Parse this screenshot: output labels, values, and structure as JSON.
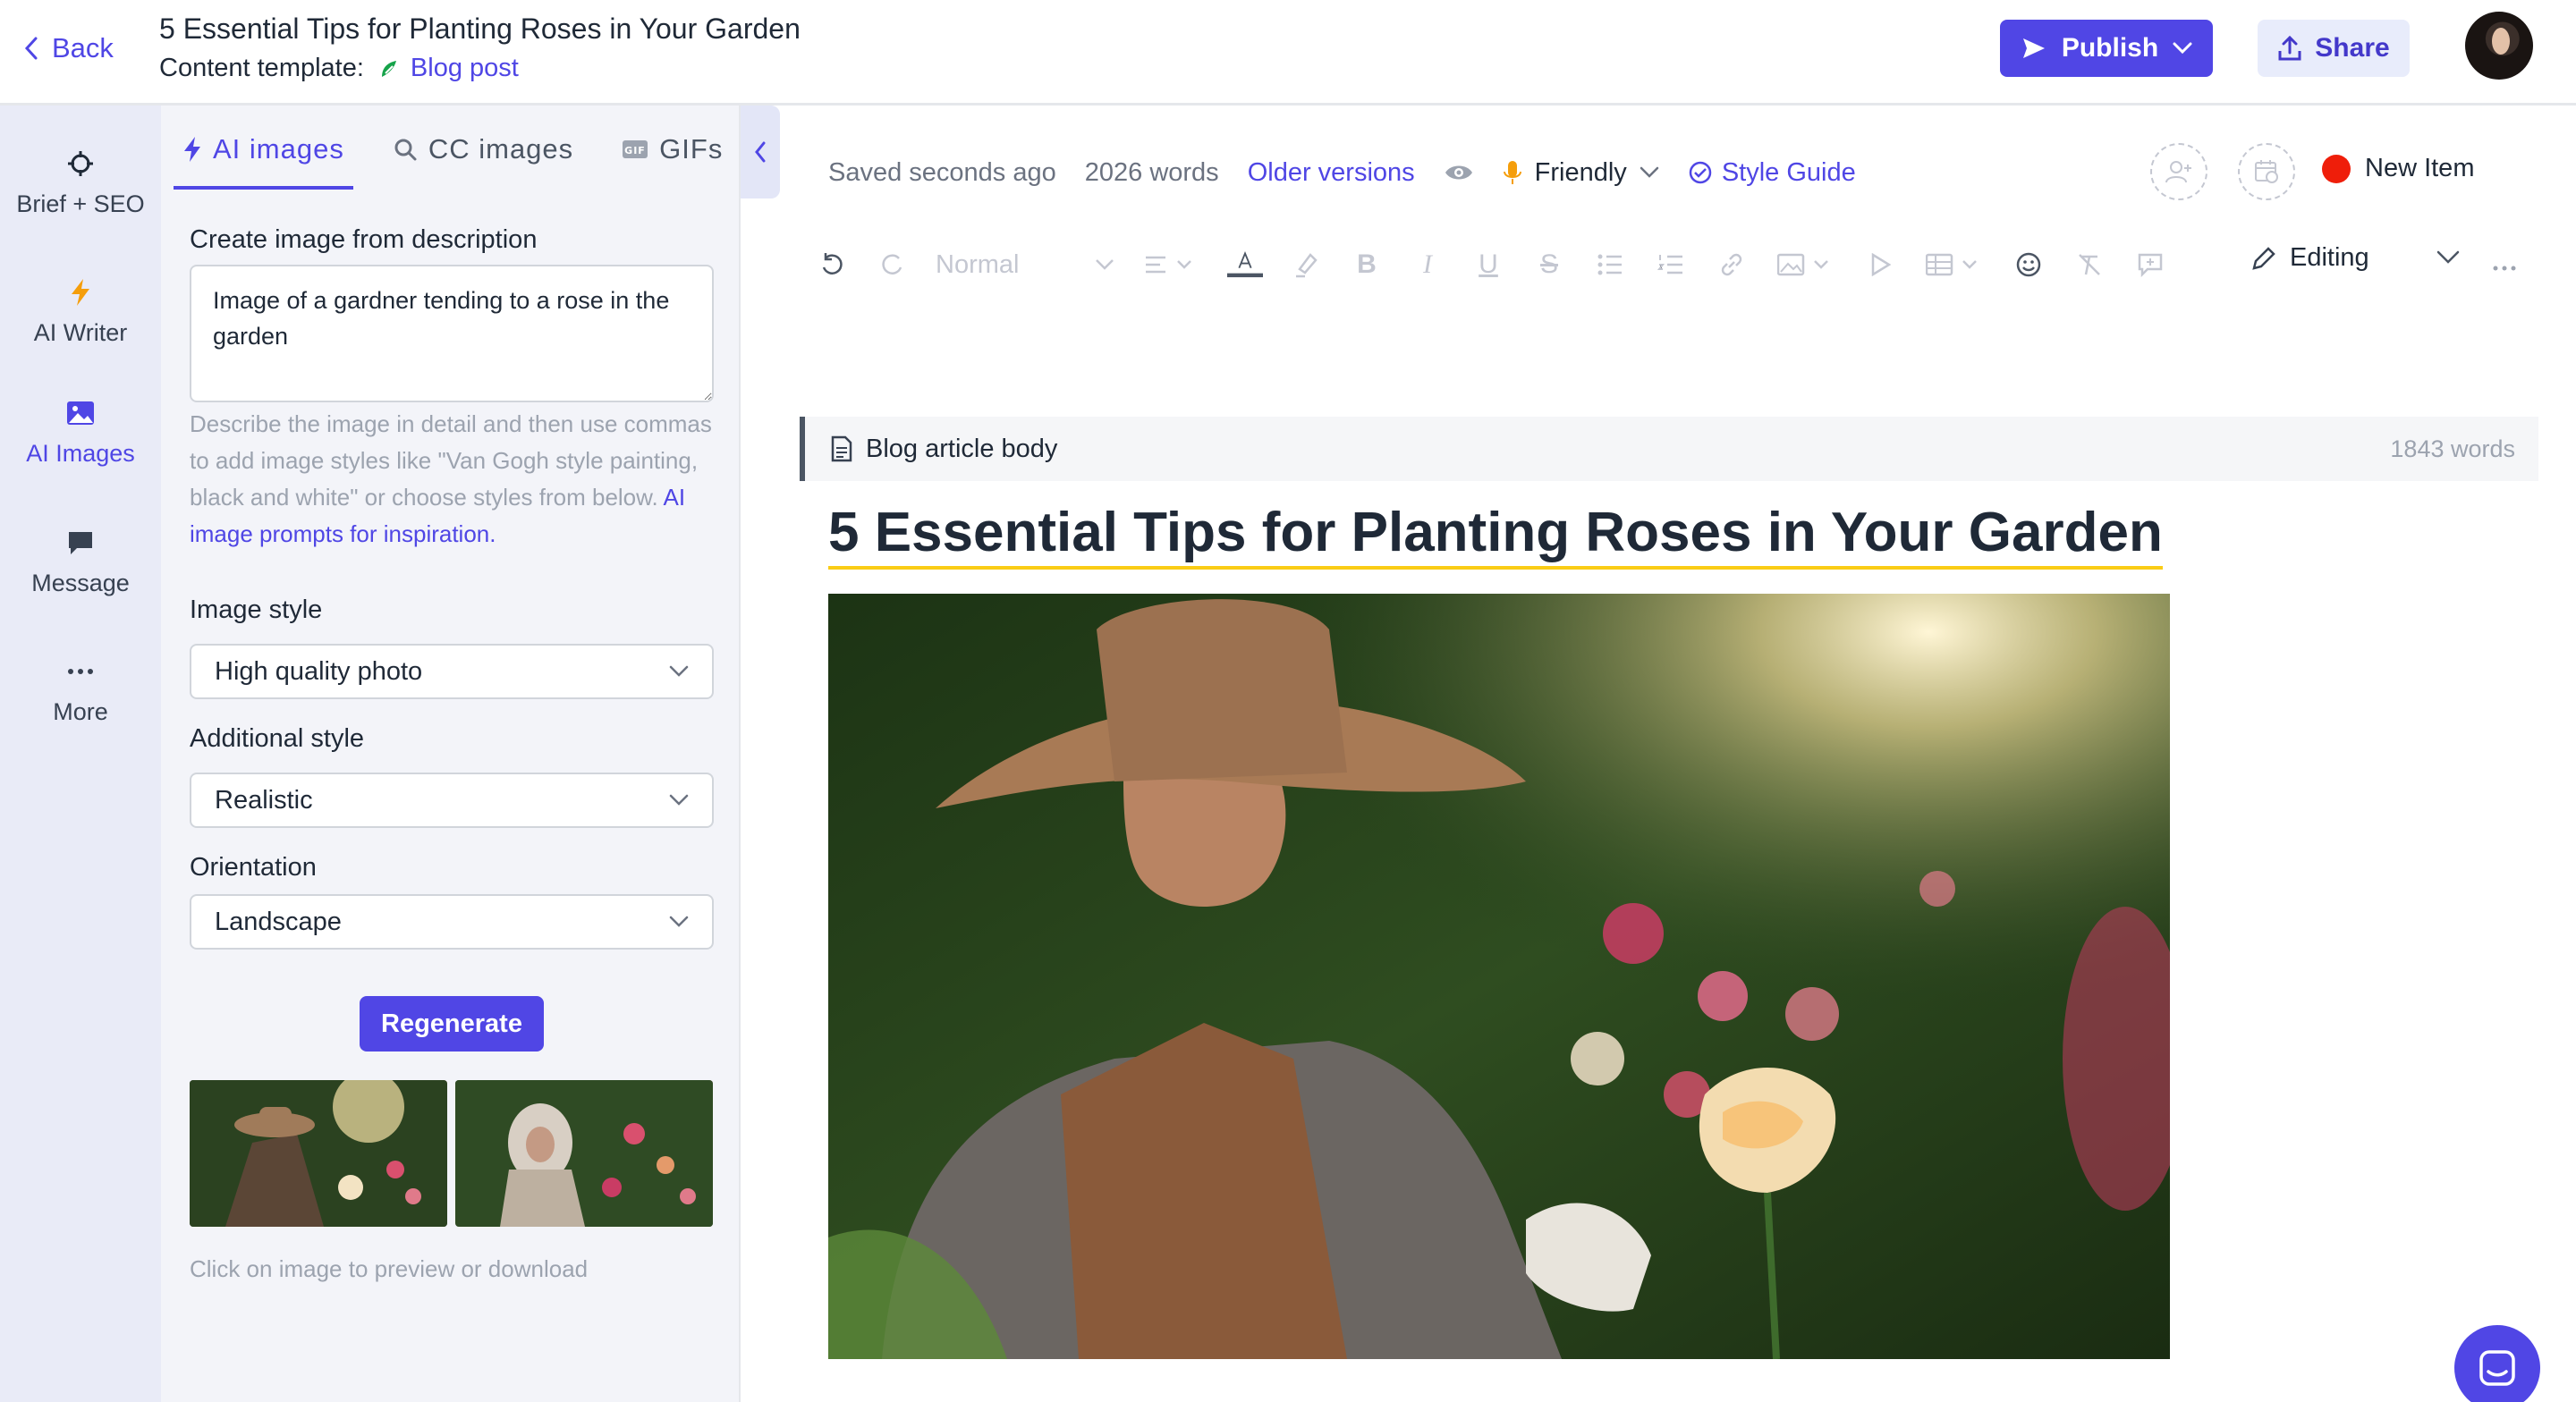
{
  "header": {
    "back_label": "Back",
    "title": "5 Essential Tips for Planting Roses in Your Garden",
    "template_label": "Content template:",
    "template_value": "Blog post",
    "publish_label": "Publish",
    "share_label": "Share"
  },
  "leftnav": {
    "items": [
      {
        "label": "Brief + SEO",
        "icon": "crosshair-icon"
      },
      {
        "label": "AI Writer",
        "icon": "bolt-icon"
      },
      {
        "label": "AI Images",
        "icon": "image-icon",
        "active": true
      },
      {
        "label": "Message",
        "icon": "message-icon"
      },
      {
        "label": "More",
        "icon": "ellipsis-icon"
      }
    ]
  },
  "panel": {
    "tabs": [
      {
        "label": "AI images",
        "active": true
      },
      {
        "label": "CC images"
      },
      {
        "label": "GIFs"
      }
    ],
    "create_label": "Create image from description",
    "description_value": "Image of a gardner tending to a rose in the garden",
    "help_text": "Describe the image in detail and then use commas to add image styles like \"Van Gogh style painting, black and white\" or choose styles from below.",
    "help_link": "AI image prompts for inspiration.",
    "image_style_label": "Image style",
    "image_style_value": "High quality photo",
    "additional_style_label": "Additional style",
    "additional_style_value": "Realistic",
    "orientation_label": "Orientation",
    "orientation_value": "Landscape",
    "regenerate_label": "Regenerate",
    "thumb_hint": "Click on image to preview or download"
  },
  "status": {
    "saved": "Saved seconds ago",
    "words": "2026 words",
    "older_versions": "Older versions",
    "tone": "Friendly",
    "style_guide": "Style Guide",
    "new_item": "New Item"
  },
  "toolbar": {
    "block_style": "Normal",
    "mode": "Editing"
  },
  "editor": {
    "section_label": "Blog article body",
    "section_words": "1843 words",
    "article_title": "5 Essential Tips for Planting Roses in Your Garden"
  },
  "colors": {
    "accent": "#5046e5",
    "status_dot": "#ef1e0a",
    "title_underline": "#facc15"
  }
}
